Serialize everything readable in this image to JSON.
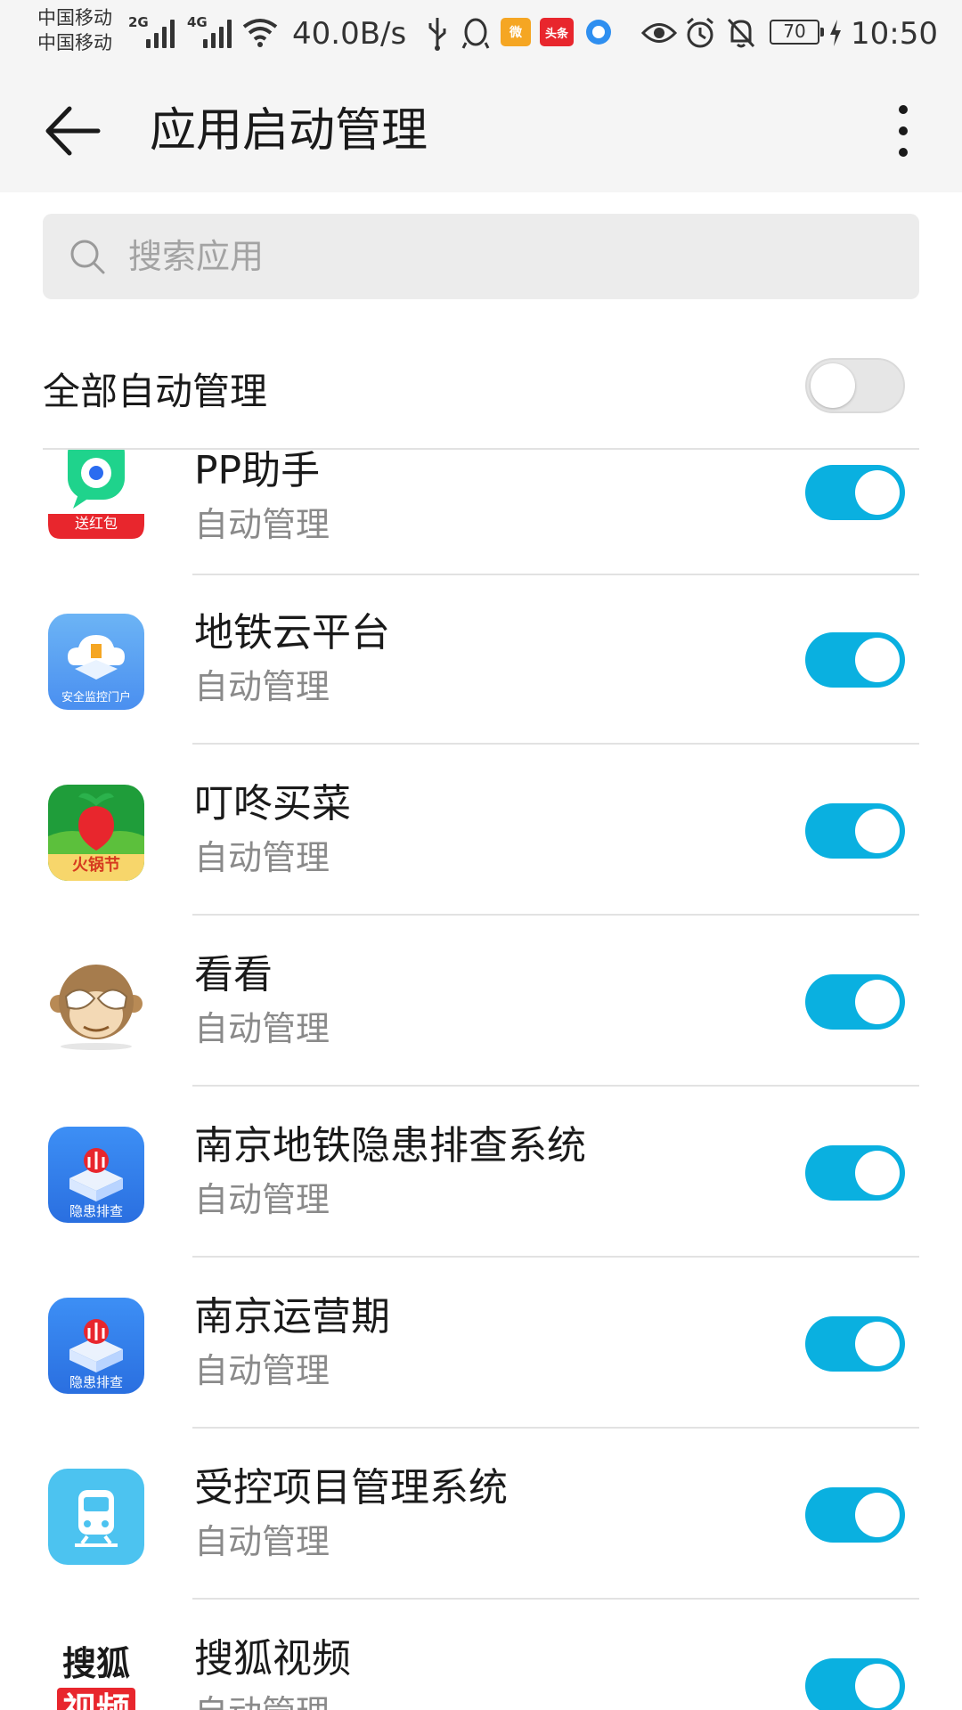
{
  "status_bar": {
    "carrier_1": "中国移动",
    "carrier_2": "中国移动",
    "network_1": "2G",
    "network_2": "4G",
    "speed": "40.0B/s",
    "notification_badge": "头条",
    "battery": "70",
    "time": "10:50"
  },
  "header": {
    "title": "应用启动管理"
  },
  "search": {
    "placeholder": "搜索应用"
  },
  "master": {
    "label": "全部自动管理",
    "enabled": false
  },
  "apps": [
    {
      "name": "PP助手",
      "status": "自动管理",
      "icon": "pp-assistant-icon",
      "icon_text": "送红包",
      "enabled": true
    },
    {
      "name": "地铁云平台",
      "status": "自动管理",
      "icon": "metro-cloud-icon",
      "icon_text": "安全监控门户",
      "enabled": true
    },
    {
      "name": "叮咚买菜",
      "status": "自动管理",
      "icon": "dingdong-icon",
      "icon_text": "火锅节",
      "enabled": true
    },
    {
      "name": "看看",
      "status": "自动管理",
      "icon": "monkey-icon",
      "enabled": true
    },
    {
      "name": "南京地铁隐患排查系统",
      "status": "自动管理",
      "icon": "nanjing-metro-icon",
      "icon_text": "隐患排查",
      "enabled": true
    },
    {
      "name": "南京运营期",
      "status": "自动管理",
      "icon": "nanjing-metro-icon",
      "icon_text": "隐患排查",
      "enabled": true
    },
    {
      "name": "受控项目管理系统",
      "status": "自动管理",
      "icon": "train-icon",
      "enabled": true
    },
    {
      "name": "搜狐视频",
      "status": "自动管理",
      "icon": "sohu-video-icon",
      "icon_text_1": "搜狐",
      "icon_text_2": "视频",
      "enabled": true
    }
  ],
  "colors": {
    "toggle_on": "#0ab0e0",
    "background": "#ffffff",
    "bar": "#f5f5f5"
  }
}
